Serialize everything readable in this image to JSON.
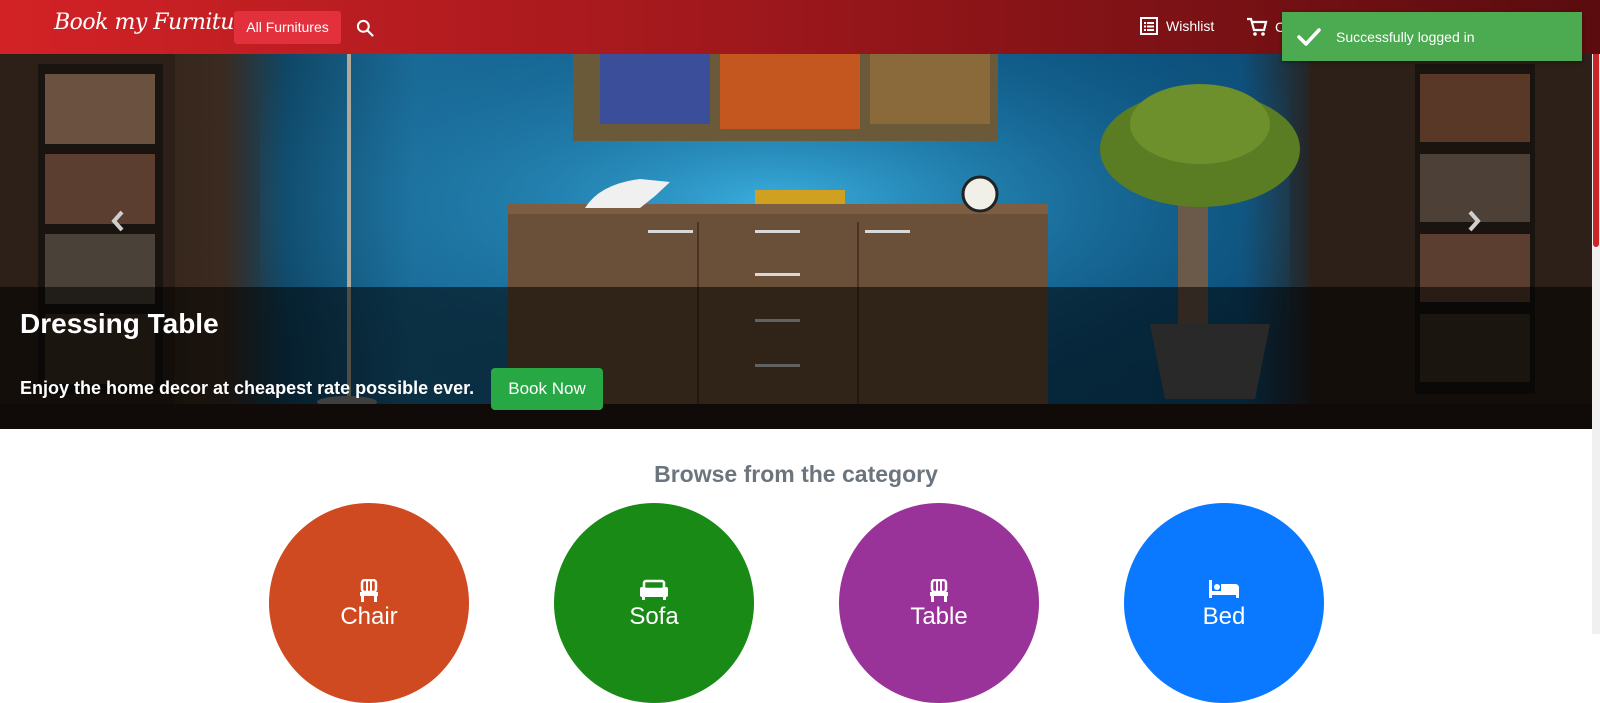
{
  "navbar": {
    "brand": "Book my Furniture",
    "all_button": "All Furnitures",
    "wishlist": "Wishlist",
    "cart": "C"
  },
  "toast": {
    "message": "Successfully logged in"
  },
  "hero": {
    "title": "Dressing Table",
    "subtitle": "Enjoy the home decor at cheapest rate possible ever.",
    "cta": "Book Now"
  },
  "categories": {
    "heading": "Browse from the category",
    "items": [
      {
        "label": "Chair",
        "color": "#cf4a20",
        "icon": "chair-icon"
      },
      {
        "label": "Sofa",
        "color": "#1a8a16",
        "icon": "sofa-icon"
      },
      {
        "label": "Table",
        "color": "#993399",
        "icon": "table-icon"
      },
      {
        "label": "Bed",
        "color": "#0a78ff",
        "icon": "bed-icon"
      }
    ]
  }
}
